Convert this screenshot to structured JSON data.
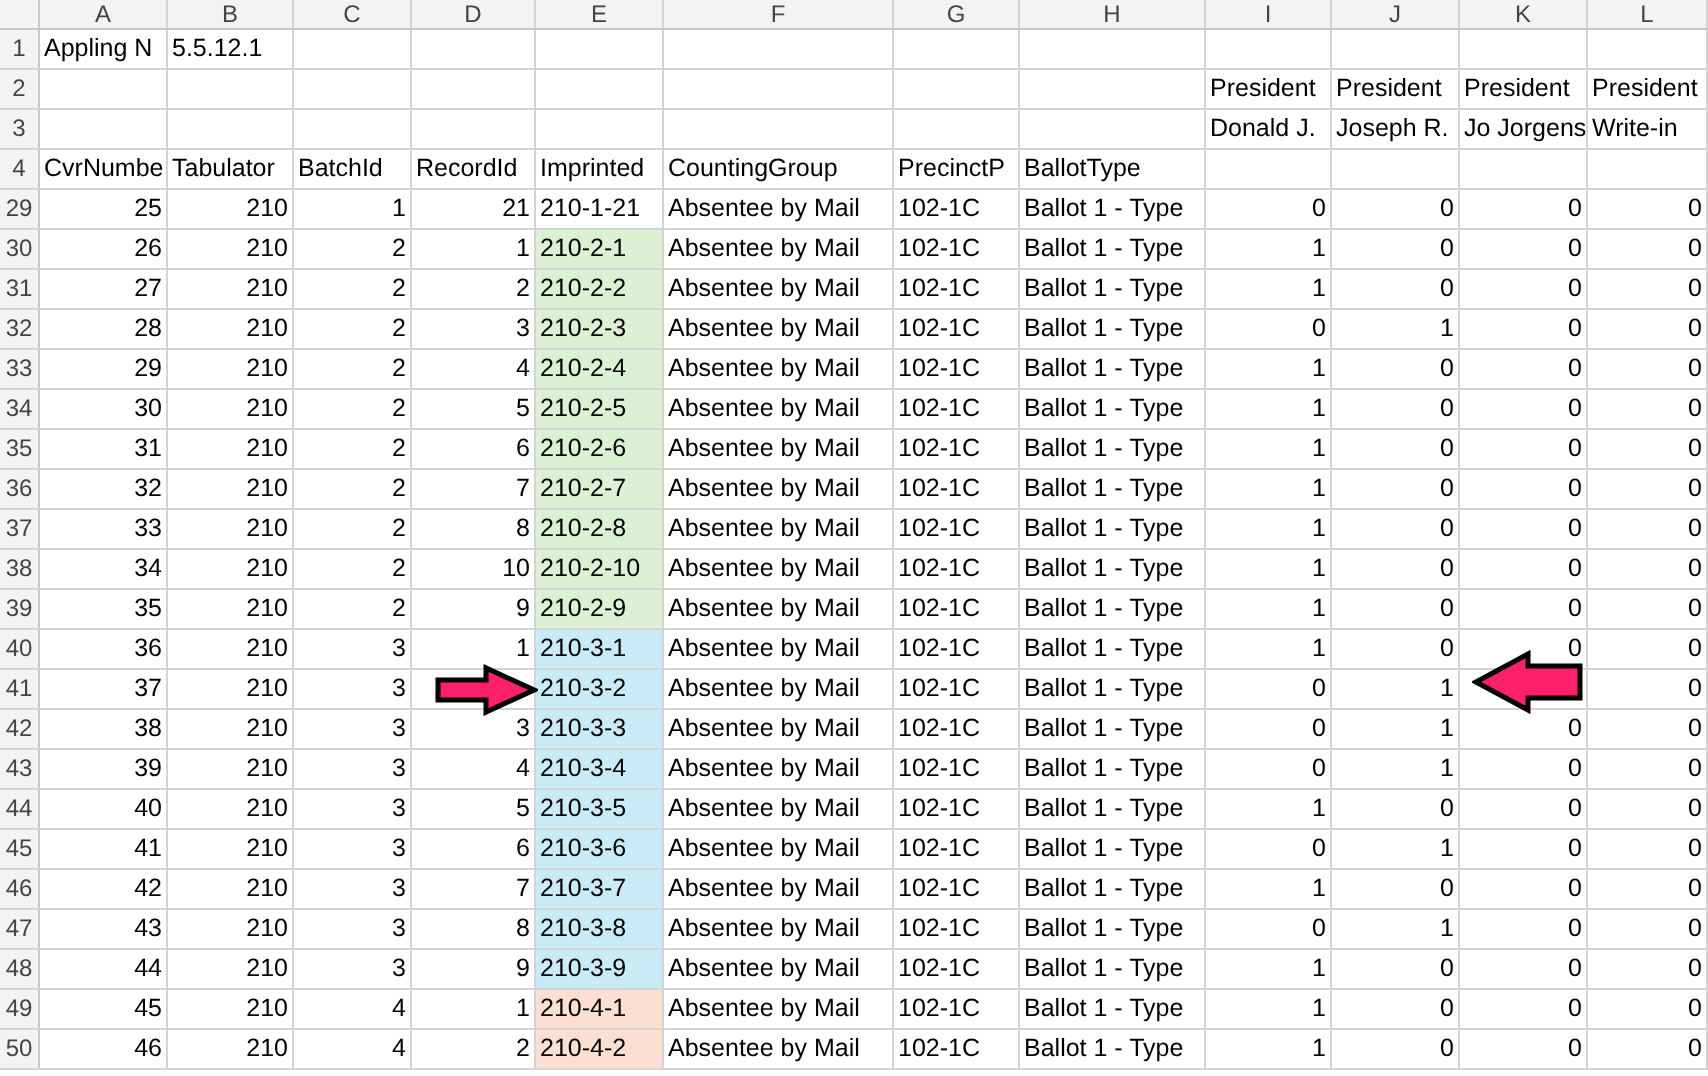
{
  "columns": [
    "A",
    "B",
    "C",
    "D",
    "E",
    "F",
    "G",
    "H",
    "I",
    "J",
    "K",
    "L"
  ],
  "row_1": {
    "num": "1",
    "cell_a": "Appling N",
    "cell_b": "5.5.12.1"
  },
  "row_2": {
    "num": "2",
    "contests": [
      "President",
      "President",
      "President",
      "President"
    ]
  },
  "row_3": {
    "num": "3",
    "candidates": [
      "Donald J.",
      "Joseph R.",
      "Jo Jorgens",
      "Write-in"
    ]
  },
  "row_4": {
    "num": "4",
    "field_names": [
      "CvrNumbe",
      "Tabulator",
      "BatchId",
      "RecordId",
      "Imprinted",
      "CountingGroup",
      "PrecinctP",
      "BallotType"
    ]
  },
  "records": [
    {
      "num": "29",
      "cvr_number": "25",
      "tabulator": "210",
      "batch_id": "1",
      "record_id": "21",
      "imprinted": "210-1-21",
      "counting_group": "Absentee by Mail",
      "precinct": "102-1C",
      "ballot_type": "Ballot 1 - Type",
      "vote_i": "0",
      "vote_j": "0",
      "vote_k": "0",
      "vote_l": "0"
    },
    {
      "num": "30",
      "cvr_number": "26",
      "tabulator": "210",
      "batch_id": "2",
      "record_id": "1",
      "imprinted": "210-2-1",
      "color": "#dcf0d4",
      "counting_group": "Absentee by Mail",
      "precinct": "102-1C",
      "ballot_type": "Ballot 1 - Type",
      "vote_i": "1",
      "vote_j": "0",
      "vote_k": "0",
      "vote_l": "0"
    },
    {
      "num": "31",
      "cvr_number": "27",
      "tabulator": "210",
      "batch_id": "2",
      "record_id": "2",
      "imprinted": "210-2-2",
      "color": "#dcf0d4",
      "counting_group": "Absentee by Mail",
      "precinct": "102-1C",
      "ballot_type": "Ballot 1 - Type",
      "vote_i": "1",
      "vote_j": "0",
      "vote_k": "0",
      "vote_l": "0"
    },
    {
      "num": "32",
      "cvr_number": "28",
      "tabulator": "210",
      "batch_id": "2",
      "record_id": "3",
      "imprinted": "210-2-3",
      "color": "#dcf0d4",
      "counting_group": "Absentee by Mail",
      "precinct": "102-1C",
      "ballot_type": "Ballot 1 - Type",
      "vote_i": "0",
      "vote_j": "1",
      "vote_k": "0",
      "vote_l": "0"
    },
    {
      "num": "33",
      "cvr_number": "29",
      "tabulator": "210",
      "batch_id": "2",
      "record_id": "4",
      "imprinted": "210-2-4",
      "color": "#dcf0d4",
      "counting_group": "Absentee by Mail",
      "precinct": "102-1C",
      "ballot_type": "Ballot 1 - Type",
      "vote_i": "1",
      "vote_j": "0",
      "vote_k": "0",
      "vote_l": "0"
    },
    {
      "num": "34",
      "cvr_number": "30",
      "tabulator": "210",
      "batch_id": "2",
      "record_id": "5",
      "imprinted": "210-2-5",
      "color": "#dcf0d4",
      "counting_group": "Absentee by Mail",
      "precinct": "102-1C",
      "ballot_type": "Ballot 1 - Type",
      "vote_i": "1",
      "vote_j": "0",
      "vote_k": "0",
      "vote_l": "0"
    },
    {
      "num": "35",
      "cvr_number": "31",
      "tabulator": "210",
      "batch_id": "2",
      "record_id": "6",
      "imprinted": "210-2-6",
      "color": "#dcf0d4",
      "counting_group": "Absentee by Mail",
      "precinct": "102-1C",
      "ballot_type": "Ballot 1 - Type",
      "vote_i": "1",
      "vote_j": "0",
      "vote_k": "0",
      "vote_l": "0"
    },
    {
      "num": "36",
      "cvr_number": "32",
      "tabulator": "210",
      "batch_id": "2",
      "record_id": "7",
      "imprinted": "210-2-7",
      "color": "#dcf0d4",
      "counting_group": "Absentee by Mail",
      "precinct": "102-1C",
      "ballot_type": "Ballot 1 - Type",
      "vote_i": "1",
      "vote_j": "0",
      "vote_k": "0",
      "vote_l": "0"
    },
    {
      "num": "37",
      "cvr_number": "33",
      "tabulator": "210",
      "batch_id": "2",
      "record_id": "8",
      "imprinted": "210-2-8",
      "color": "#dcf0d4",
      "counting_group": "Absentee by Mail",
      "precinct": "102-1C",
      "ballot_type": "Ballot 1 - Type",
      "vote_i": "1",
      "vote_j": "0",
      "vote_k": "0",
      "vote_l": "0"
    },
    {
      "num": "38",
      "cvr_number": "34",
      "tabulator": "210",
      "batch_id": "2",
      "record_id": "10",
      "imprinted": "210-2-10",
      "color": "#dcf0d4",
      "counting_group": "Absentee by Mail",
      "precinct": "102-1C",
      "ballot_type": "Ballot 1 - Type",
      "vote_i": "1",
      "vote_j": "0",
      "vote_k": "0",
      "vote_l": "0"
    },
    {
      "num": "39",
      "cvr_number": "35",
      "tabulator": "210",
      "batch_id": "2",
      "record_id": "9",
      "imprinted": "210-2-9",
      "color": "#dcf0d4",
      "counting_group": "Absentee by Mail",
      "precinct": "102-1C",
      "ballot_type": "Ballot 1 - Type",
      "vote_i": "1",
      "vote_j": "0",
      "vote_k": "0",
      "vote_l": "0"
    },
    {
      "num": "40",
      "cvr_number": "36",
      "tabulator": "210",
      "batch_id": "3",
      "record_id": "1",
      "imprinted": "210-3-1",
      "color": "#c9ebf8",
      "counting_group": "Absentee by Mail",
      "precinct": "102-1C",
      "ballot_type": "Ballot 1 - Type",
      "vote_i": "1",
      "vote_j": "0",
      "vote_k": "0",
      "vote_l": "0"
    },
    {
      "num": "41",
      "cvr_number": "37",
      "tabulator": "210",
      "batch_id": "3",
      "imprinted": "210-3-2",
      "color": "#c9ebf8",
      "counting_group": "Absentee by Mail",
      "precinct": "102-1C",
      "ballot_type": "Ballot 1 - Type",
      "vote_i": "0",
      "vote_j": "1",
      "vote_l": "0"
    },
    {
      "num": "42",
      "cvr_number": "38",
      "tabulator": "210",
      "batch_id": "3",
      "record_id": "3",
      "imprinted": "210-3-3",
      "color": "#c9ebf8",
      "counting_group": "Absentee by Mail",
      "precinct": "102-1C",
      "ballot_type": "Ballot 1 - Type",
      "vote_i": "0",
      "vote_j": "1",
      "vote_k": "0",
      "vote_l": "0"
    },
    {
      "num": "43",
      "cvr_number": "39",
      "tabulator": "210",
      "batch_id": "3",
      "record_id": "4",
      "imprinted": "210-3-4",
      "color": "#c9ebf8",
      "counting_group": "Absentee by Mail",
      "precinct": "102-1C",
      "ballot_type": "Ballot 1 - Type",
      "vote_i": "0",
      "vote_j": "1",
      "vote_k": "0",
      "vote_l": "0"
    },
    {
      "num": "44",
      "cvr_number": "40",
      "tabulator": "210",
      "batch_id": "3",
      "record_id": "5",
      "imprinted": "210-3-5",
      "color": "#c9ebf8",
      "counting_group": "Absentee by Mail",
      "precinct": "102-1C",
      "ballot_type": "Ballot 1 - Type",
      "vote_i": "1",
      "vote_j": "0",
      "vote_k": "0",
      "vote_l": "0"
    },
    {
      "num": "45",
      "cvr_number": "41",
      "tabulator": "210",
      "batch_id": "3",
      "record_id": "6",
      "imprinted": "210-3-6",
      "color": "#c9ebf8",
      "counting_group": "Absentee by Mail",
      "precinct": "102-1C",
      "ballot_type": "Ballot 1 - Type",
      "vote_i": "0",
      "vote_j": "1",
      "vote_k": "0",
      "vote_l": "0"
    },
    {
      "num": "46",
      "cvr_number": "42",
      "tabulator": "210",
      "batch_id": "3",
      "record_id": "7",
      "imprinted": "210-3-7",
      "color": "#c9ebf8",
      "counting_group": "Absentee by Mail",
      "precinct": "102-1C",
      "ballot_type": "Ballot 1 - Type",
      "vote_i": "1",
      "vote_j": "0",
      "vote_k": "0",
      "vote_l": "0"
    },
    {
      "num": "47",
      "cvr_number": "43",
      "tabulator": "210",
      "batch_id": "3",
      "record_id": "8",
      "imprinted": "210-3-8",
      "color": "#c9ebf8",
      "counting_group": "Absentee by Mail",
      "precinct": "102-1C",
      "ballot_type": "Ballot 1 - Type",
      "vote_i": "0",
      "vote_j": "1",
      "vote_k": "0",
      "vote_l": "0"
    },
    {
      "num": "48",
      "cvr_number": "44",
      "tabulator": "210",
      "batch_id": "3",
      "record_id": "9",
      "imprinted": "210-3-9",
      "color": "#c9ebf8",
      "counting_group": "Absentee by Mail",
      "precinct": "102-1C",
      "ballot_type": "Ballot 1 - Type",
      "vote_i": "1",
      "vote_j": "0",
      "vote_k": "0",
      "vote_l": "0"
    },
    {
      "num": "49",
      "cvr_number": "45",
      "tabulator": "210",
      "batch_id": "4",
      "record_id": "1",
      "imprinted": "210-4-1",
      "color": "#fbe0d2",
      "counting_group": "Absentee by Mail",
      "precinct": "102-1C",
      "ballot_type": "Ballot 1 - Type",
      "vote_i": "1",
      "vote_j": "0",
      "vote_k": "0",
      "vote_l": "0"
    },
    {
      "num": "50",
      "cvr_number": "46",
      "tabulator": "210",
      "batch_id": "4",
      "record_id": "2",
      "imprinted": "210-4-2",
      "color": "#fbe0d2",
      "counting_group": "Absentee by Mail",
      "precinct": "102-1C",
      "ballot_type": "Ballot 1 - Type",
      "vote_i": "1",
      "vote_j": "0",
      "vote_k": "0",
      "vote_l": "0"
    }
  ]
}
